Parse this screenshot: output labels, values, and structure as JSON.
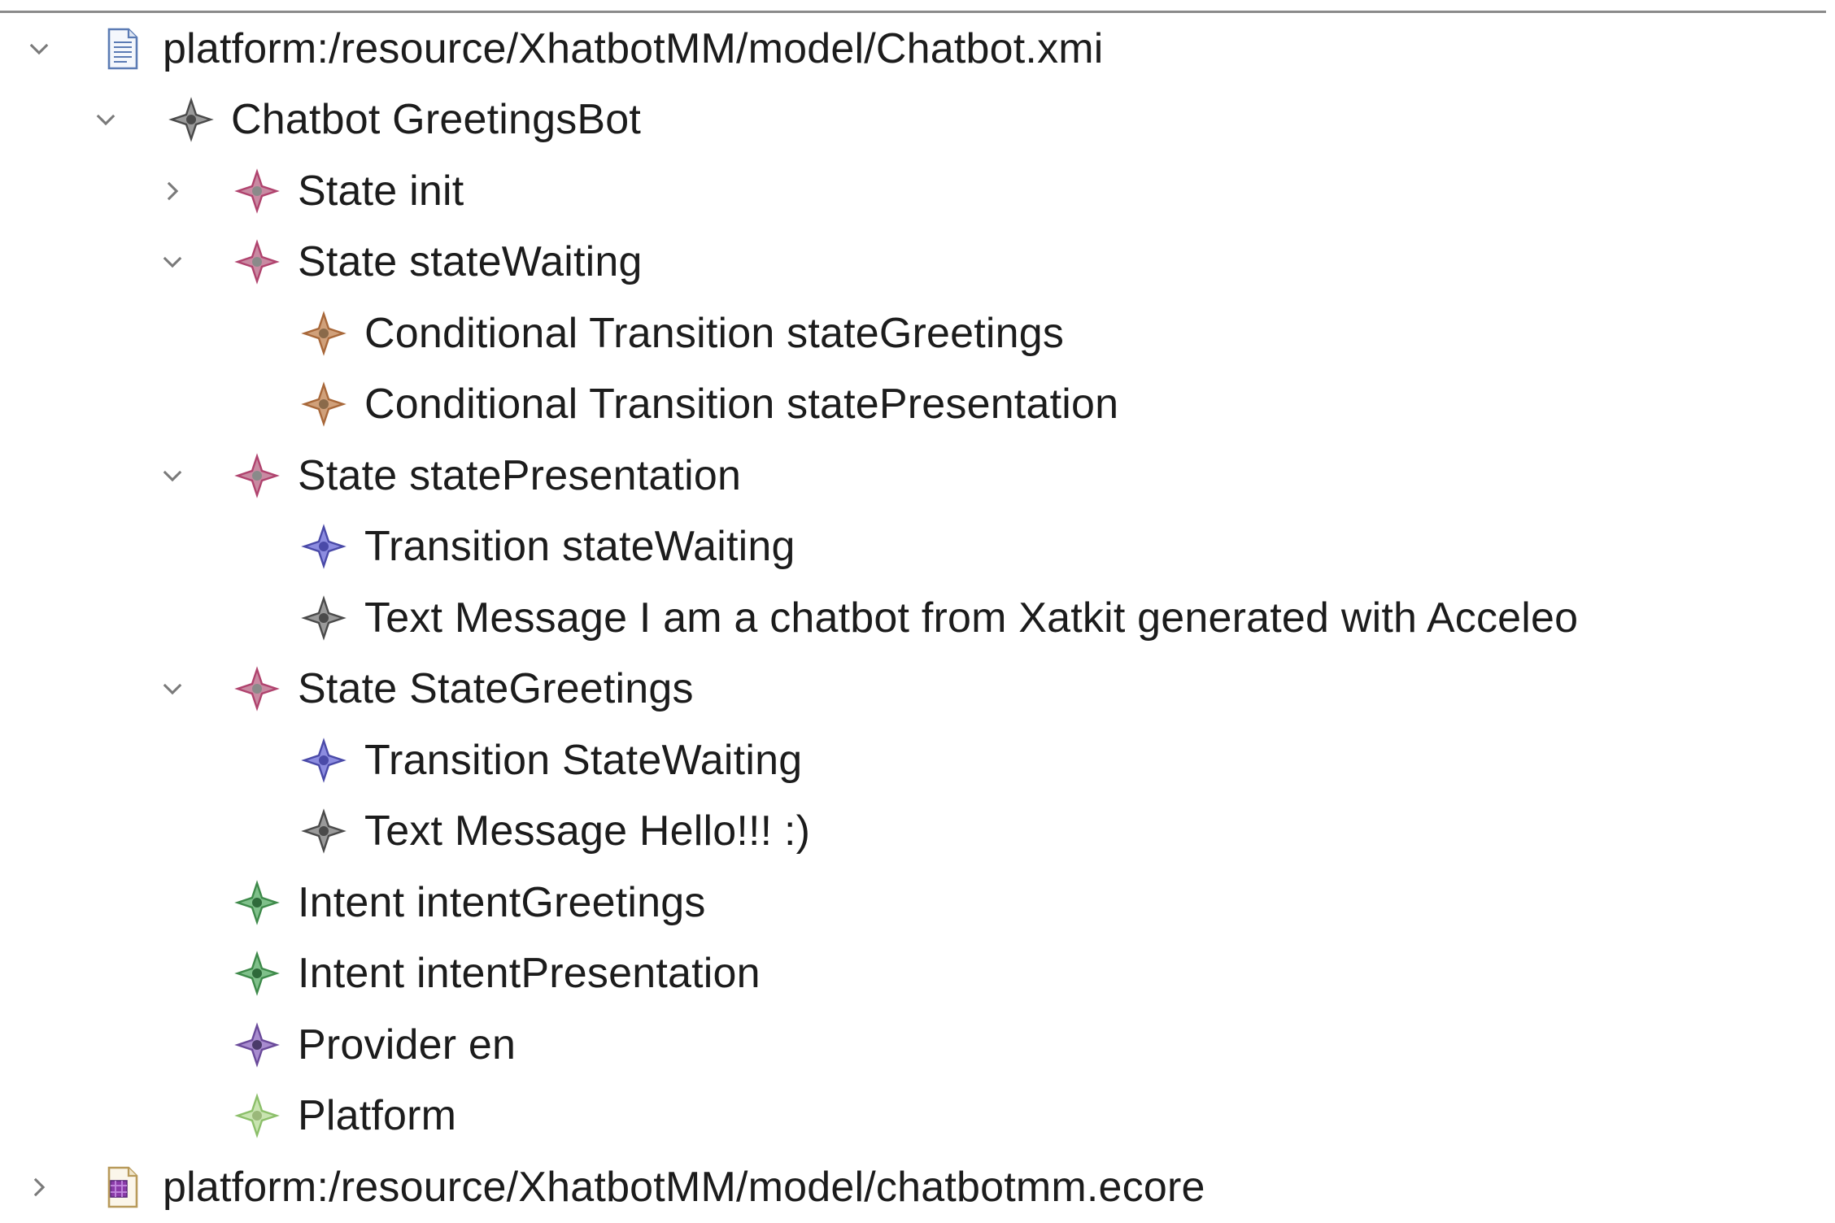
{
  "tree": {
    "rows": [
      {
        "label": "platform:/resource/XhatbotMM/model/Chatbot.xmi",
        "icon": "xmi-file-icon",
        "expanded": true
      },
      {
        "label": "Chatbot GreetingsBot",
        "icon": "chatbot-node-icon",
        "color": "#5a5a5a",
        "expanded": true
      },
      {
        "label": "State init",
        "icon": "state-node-icon",
        "color": "#b0436e",
        "expanded": false
      },
      {
        "label": "State stateWaiting",
        "icon": "state-node-icon",
        "color": "#b0436e",
        "expanded": true
      },
      {
        "label": "Conditional Transition stateGreetings",
        "icon": "conditional-transition-icon",
        "color": "#a8683a"
      },
      {
        "label": "Conditional Transition statePresentation",
        "icon": "conditional-transition-icon",
        "color": "#a8683a"
      },
      {
        "label": "State statePresentation",
        "icon": "state-node-icon",
        "color": "#b0436e",
        "expanded": true
      },
      {
        "label": "Transition stateWaiting",
        "icon": "transition-icon",
        "color": "#4a4aa8"
      },
      {
        "label": "Text Message I am a chatbot from Xatkit generated with Acceleo",
        "icon": "text-message-icon",
        "color": "#5a5a5a"
      },
      {
        "label": "State StateGreetings",
        "icon": "state-node-icon",
        "color": "#b0436e",
        "expanded": true
      },
      {
        "label": "Transition StateWaiting",
        "icon": "transition-icon",
        "color": "#4a4aa8"
      },
      {
        "label": "Text Message Hello!!! :)",
        "icon": "text-message-icon",
        "color": "#5a5a5a"
      },
      {
        "label": "Intent intentGreetings",
        "icon": "intent-icon",
        "color": "#3e8a4a"
      },
      {
        "label": "Intent intentPresentation",
        "icon": "intent-icon",
        "color": "#3e8a4a"
      },
      {
        "label": "Provider en",
        "icon": "provider-icon",
        "color": "#6a4a9a"
      },
      {
        "label": "Platform",
        "icon": "platform-icon",
        "color": "#8cbf6a"
      },
      {
        "label": "platform:/resource/XhatbotMM/model/chatbotmm.ecore",
        "icon": "ecore-file-icon",
        "expanded": false
      }
    ]
  }
}
